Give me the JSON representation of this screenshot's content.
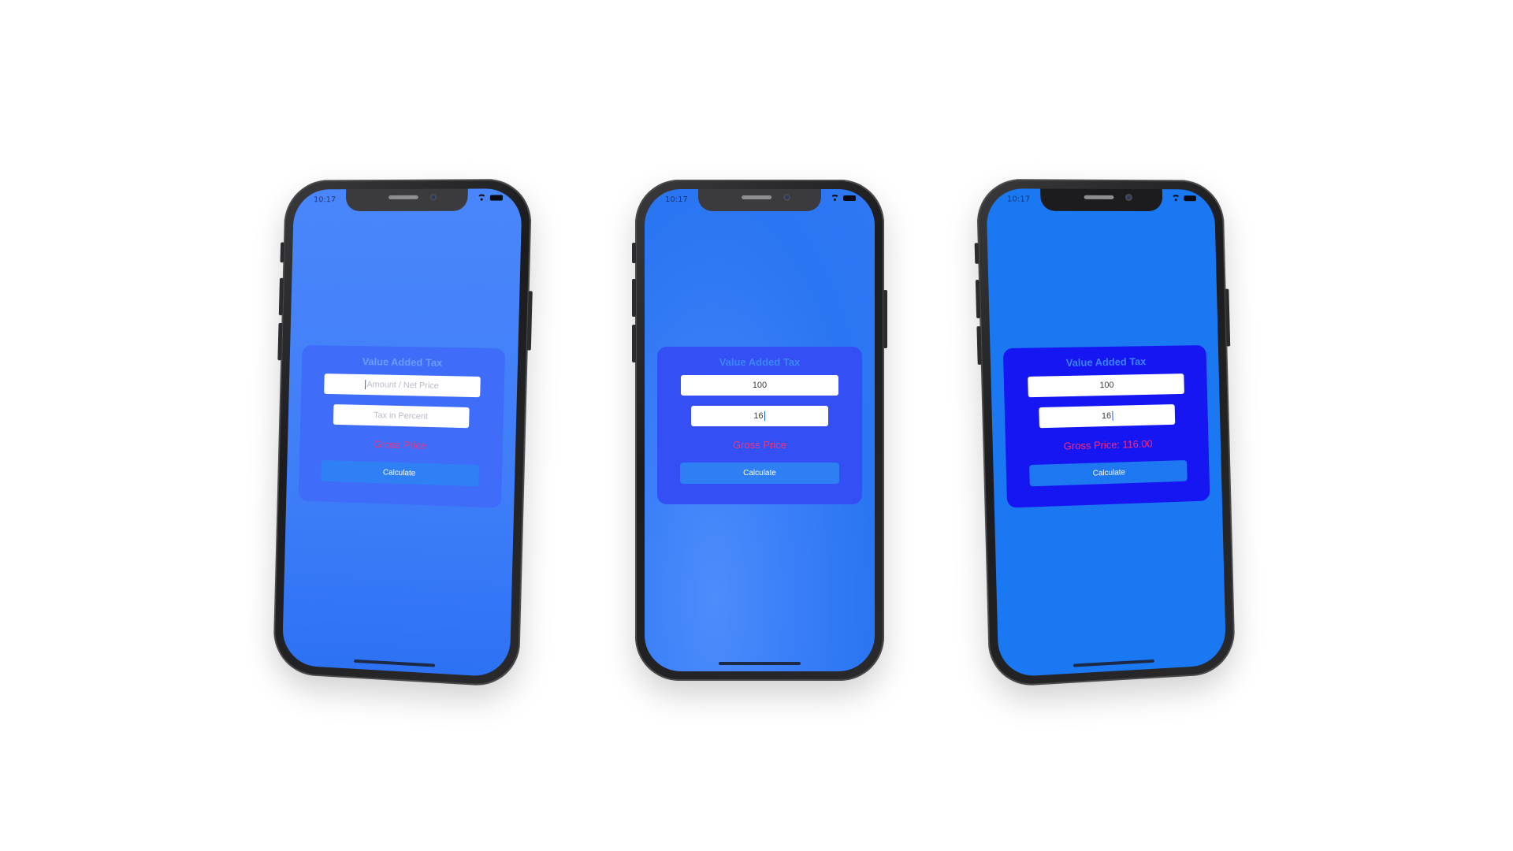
{
  "status_bar": {
    "time": "10:17"
  },
  "screens": [
    {
      "title": "Value Added Tax",
      "amount": {
        "value": "",
        "placeholder": "Amount / Net Price"
      },
      "tax": {
        "value": "",
        "placeholder": "Tax in Percent"
      },
      "gross_label": "Gross Price",
      "button_label": "Calculate"
    },
    {
      "title": "Value Added Tax",
      "amount": {
        "value": "100",
        "placeholder": "Amount / Net Price"
      },
      "tax": {
        "value": "16",
        "placeholder": "Tax in Percent"
      },
      "gross_label": "Gross Price",
      "button_label": "Calculate"
    },
    {
      "title": "Value Added Tax",
      "amount": {
        "value": "100",
        "placeholder": "Amount / Net Price"
      },
      "tax": {
        "value": "16",
        "placeholder": "Tax in Percent"
      },
      "gross_label": "Gross Price: 116.00",
      "button_label": "Calculate"
    }
  ],
  "colors": {
    "card_title": "#3b85f6",
    "gross_text": "#f0367a",
    "button": "#2f80f5",
    "screen_blue": "#1a78f2",
    "card_dark": "#1616f2"
  }
}
